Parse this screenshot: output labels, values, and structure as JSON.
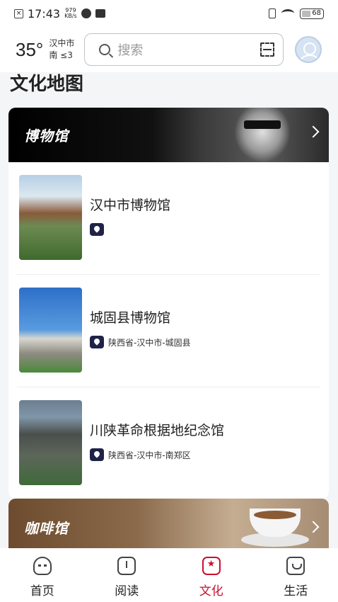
{
  "status_bar": {
    "time": "17:43",
    "speed_value": "979",
    "speed_unit": "KB/s",
    "battery": "68"
  },
  "header": {
    "temperature": "35°",
    "city": "汉中市",
    "wind": "南 ≤3",
    "search_placeholder": "搜索"
  },
  "section_title": "文化地图",
  "museum": {
    "banner_title": "博物馆",
    "items": [
      {
        "name": "汉中市博物馆",
        "location": ""
      },
      {
        "name": "城固县博物馆",
        "location": "陕西省-汉中市-城固县"
      },
      {
        "name": "川陕革命根据地纪念馆",
        "location": "陕西省-汉中市-南郑区"
      }
    ]
  },
  "coffee": {
    "banner_title": "咖啡馆"
  },
  "tabs": [
    {
      "label": "首页",
      "icon": "home-icon"
    },
    {
      "label": "阅读",
      "icon": "book-icon"
    },
    {
      "label": "文化",
      "icon": "culture-icon",
      "active": true
    },
    {
      "label": "生活",
      "icon": "life-icon"
    }
  ],
  "colors": {
    "accent": "#c8102e",
    "pin": "#1f2346"
  }
}
